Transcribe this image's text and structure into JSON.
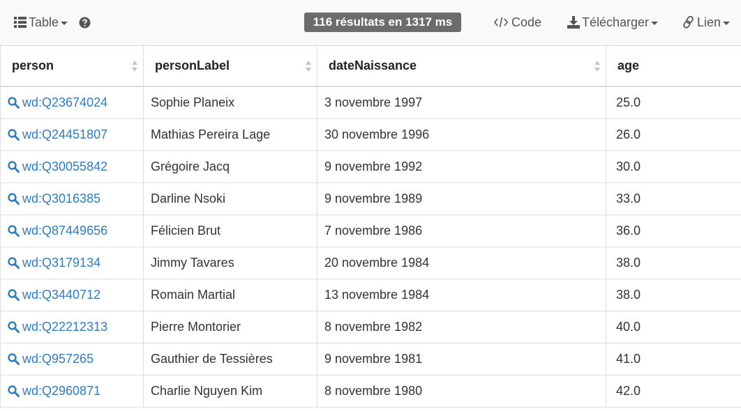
{
  "toolbar": {
    "table_label": "Table",
    "help_icon": "question-circle-icon",
    "results_badge": "116 résultats en 1317 ms",
    "code_label": "Code",
    "download_label": "Télécharger",
    "link_label": "Lien"
  },
  "table": {
    "columns": [
      "person",
      "personLabel",
      "dateNaissance",
      "age"
    ],
    "rows": [
      {
        "person": "wd:Q23674024",
        "label": "Sophie Planeix",
        "date": "3 novembre 1997",
        "age": "25.0"
      },
      {
        "person": "wd:Q24451807",
        "label": "Mathias Pereira Lage",
        "date": "30 novembre 1996",
        "age": "26.0"
      },
      {
        "person": "wd:Q30055842",
        "label": "Grégoire Jacq",
        "date": "9 novembre 1992",
        "age": "30.0"
      },
      {
        "person": "wd:Q3016385",
        "label": "Darline Nsoki",
        "date": "9 novembre 1989",
        "age": "33.0"
      },
      {
        "person": "wd:Q87449656",
        "label": "Félicien Brut",
        "date": "7 novembre 1986",
        "age": "36.0"
      },
      {
        "person": "wd:Q3179134",
        "label": "Jimmy Tavares",
        "date": "20 novembre 1984",
        "age": "38.0"
      },
      {
        "person": "wd:Q3440712",
        "label": "Romain Martial",
        "date": "13 novembre 1984",
        "age": "38.0"
      },
      {
        "person": "wd:Q22212313",
        "label": "Pierre Montorier",
        "date": "8 novembre 1982",
        "age": "40.0"
      },
      {
        "person": "wd:Q957265",
        "label": "Gauthier de Tessières",
        "date": "9 novembre 1981",
        "age": "41.0"
      },
      {
        "person": "wd:Q2960871",
        "label": "Charlie Nguyen Kim",
        "date": "8 novembre 1980",
        "age": "42.0"
      }
    ]
  }
}
